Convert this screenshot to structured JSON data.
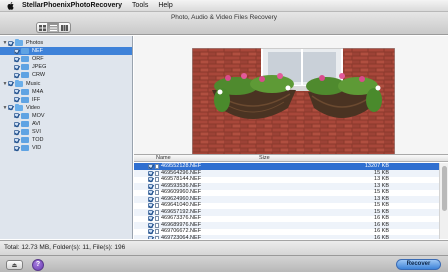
{
  "menubar": {
    "app_name": "StellarPhoenixPhotoRecovery",
    "items": [
      "Tools",
      "Help"
    ]
  },
  "window": {
    "title": "Photo, Audio & Video Files Recovery"
  },
  "view_modes": [
    "icon-view",
    "list-view",
    "column-view"
  ],
  "tree": [
    {
      "label": "Photos",
      "level": 0,
      "kind": "group",
      "selected": false
    },
    {
      "label": "NEF",
      "level": 1,
      "kind": "folder",
      "selected": true
    },
    {
      "label": "ORF",
      "level": 1,
      "kind": "folder",
      "selected": false
    },
    {
      "label": "JPEG",
      "level": 1,
      "kind": "folder",
      "selected": false
    },
    {
      "label": "CRW",
      "level": 1,
      "kind": "folder",
      "selected": false
    },
    {
      "label": "Music",
      "level": 0,
      "kind": "group",
      "selected": false
    },
    {
      "label": "M4A",
      "level": 1,
      "kind": "folder",
      "selected": false
    },
    {
      "label": "IFF",
      "level": 1,
      "kind": "folder",
      "selected": false
    },
    {
      "label": "Video",
      "level": 0,
      "kind": "group",
      "selected": false
    },
    {
      "label": "MOV",
      "level": 1,
      "kind": "folder",
      "selected": false
    },
    {
      "label": "AVI",
      "level": 1,
      "kind": "folder",
      "selected": false
    },
    {
      "label": "SVI",
      "level": 1,
      "kind": "folder",
      "selected": false
    },
    {
      "label": "TOD",
      "level": 1,
      "kind": "folder",
      "selected": false
    },
    {
      "label": "VID",
      "level": 1,
      "kind": "folder",
      "selected": false
    }
  ],
  "file_list": {
    "columns": {
      "name": "Name",
      "size": "Size"
    },
    "rows": [
      {
        "name": "469552128.NEF",
        "size": "13207 KB",
        "selected": true
      },
      {
        "name": "469564296.NEF",
        "size": "15 KB",
        "selected": false
      },
      {
        "name": "469578144.NEF",
        "size": "13 KB",
        "selected": false
      },
      {
        "name": "469593536.NEF",
        "size": "13 KB",
        "selected": false
      },
      {
        "name": "469609960.NEF",
        "size": "15 KB",
        "selected": false
      },
      {
        "name": "469624960.NEF",
        "size": "13 KB",
        "selected": false
      },
      {
        "name": "469641040.NEF",
        "size": "15 KB",
        "selected": false
      },
      {
        "name": "469657192.NEF",
        "size": "15 KB",
        "selected": false
      },
      {
        "name": "469673376.NEF",
        "size": "16 KB",
        "selected": false
      },
      {
        "name": "469689976.NEF",
        "size": "16 KB",
        "selected": false
      },
      {
        "name": "469706672.NEF",
        "size": "16 KB",
        "selected": false
      },
      {
        "name": "469723064.NEF",
        "size": "16 KB",
        "selected": false
      }
    ]
  },
  "status": {
    "text": "Total: 12.73 MB, Folder(s): 11, File(s): 196"
  },
  "bottom": {
    "eject_label": "⏏",
    "help_label": "?",
    "recover_label": "Recover"
  },
  "colors": {
    "selection": "#3e82d9",
    "sidebar_bg": "#dfe5ed",
    "recover_button": "#3d83d8"
  }
}
